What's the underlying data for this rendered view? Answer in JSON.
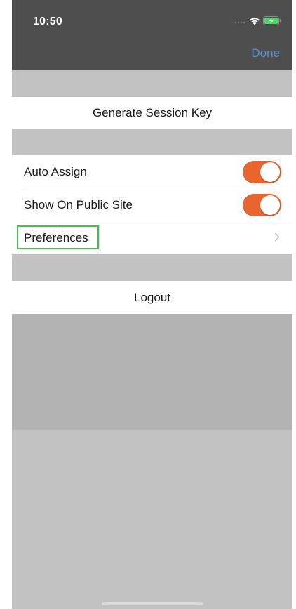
{
  "status_bar": {
    "time": "10:50"
  },
  "nav": {
    "done_label": "Done"
  },
  "cells": {
    "generate_session_key": "Generate Session Key",
    "auto_assign": {
      "label": "Auto Assign",
      "on": true
    },
    "show_on_public_site": {
      "label": "Show On Public Site",
      "on": true
    },
    "preferences": "Preferences",
    "logout": "Logout"
  },
  "colors": {
    "accent_toggle": "#e8652f",
    "done_blue": "#5a8fd0",
    "highlight_green": "#3ec64a"
  },
  "icons": [
    "signal-dots-icon",
    "wifi-icon",
    "battery-charging-icon",
    "chevron-right-icon"
  ]
}
